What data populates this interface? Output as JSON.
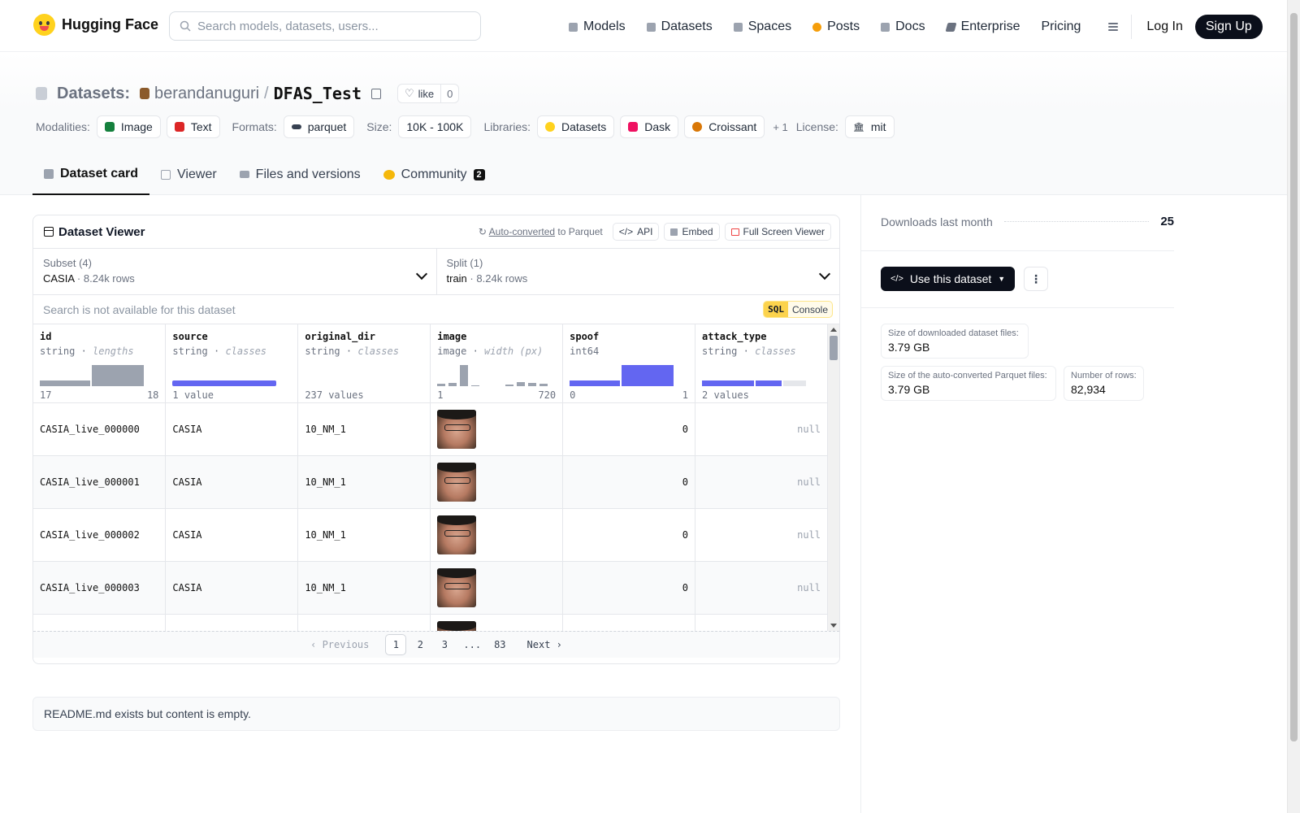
{
  "nav": {
    "brand": "Hugging Face",
    "search_placeholder": "Search models, datasets, users...",
    "links": [
      "Models",
      "Datasets",
      "Spaces",
      "Posts",
      "Docs",
      "Enterprise",
      "Pricing"
    ],
    "login": "Log In",
    "signup": "Sign Up"
  },
  "header": {
    "section": "Datasets:",
    "owner": "berandanuguri",
    "slash": "/",
    "name": "DFAS_Test",
    "like_label": "like",
    "like_count": "0",
    "modalities_label": "Modalities:",
    "modalities": [
      "Image",
      "Text"
    ],
    "formats_label": "Formats:",
    "format": "parquet",
    "size_label": "Size:",
    "size": "10K - 100K",
    "libraries_label": "Libraries:",
    "libraries": [
      "Datasets",
      "Dask",
      "Croissant"
    ],
    "more_libraries": "+ 1",
    "license_label": "License:",
    "license": "mit"
  },
  "tabs": {
    "card": "Dataset card",
    "viewer": "Viewer",
    "files": "Files and versions",
    "community": "Community",
    "community_count": "2"
  },
  "viewer": {
    "title": "Dataset Viewer",
    "auto_converted": "Auto-converted",
    "to_parquet": "to Parquet",
    "api": "API",
    "embed": "Embed",
    "fullscreen": "Full Screen Viewer",
    "subset_label": "Subset (4)",
    "subset_value": "CASIA",
    "subset_rows": "8.24k rows",
    "split_label": "Split (1)",
    "split_value": "train",
    "split_rows": "8.24k rows",
    "search_placeholder": "Search is not available for this dataset",
    "sql": "SQL",
    "console": "Console",
    "columns": [
      {
        "name": "id",
        "type": "string",
        "stat": "lengths",
        "min": "17",
        "max": "18"
      },
      {
        "name": "source",
        "type": "string",
        "stat": "classes",
        "min": "1 value",
        "max": ""
      },
      {
        "name": "original_dir",
        "type": "string",
        "stat": "classes",
        "min": "237 values",
        "max": ""
      },
      {
        "name": "image",
        "type": "image",
        "stat": "width (px)",
        "min": "1",
        "max": "720"
      },
      {
        "name": "spoof",
        "type": "int64",
        "stat": "",
        "min": "0",
        "max": "1"
      },
      {
        "name": "attack_type",
        "type": "string",
        "stat": "classes",
        "min": "2 values",
        "max": ""
      }
    ],
    "rows": [
      {
        "id": "CASIA_live_000000",
        "source": "CASIA",
        "original_dir": "10_NM_1",
        "spoof": "0",
        "attack_type": "null"
      },
      {
        "id": "CASIA_live_000001",
        "source": "CASIA",
        "original_dir": "10_NM_1",
        "spoof": "0",
        "attack_type": "null"
      },
      {
        "id": "CASIA_live_000002",
        "source": "CASIA",
        "original_dir": "10_NM_1",
        "spoof": "0",
        "attack_type": "null"
      },
      {
        "id": "CASIA_live_000003",
        "source": "CASIA",
        "original_dir": "10_NM_1",
        "spoof": "0",
        "attack_type": "null"
      }
    ],
    "pager": {
      "previous": "Previous",
      "pages": [
        "1",
        "2",
        "3",
        "...",
        "83"
      ],
      "next": "Next"
    }
  },
  "sidebar": {
    "downloads_label": "Downloads last month",
    "downloads_value": "25",
    "use_button": "Use this dataset",
    "downloaded_size_label": "Size of downloaded dataset files:",
    "downloaded_size": "3.79 GB",
    "parquet_size_label": "Size of the auto-converted Parquet files:",
    "parquet_size": "3.79 GB",
    "num_rows_label": "Number of rows:",
    "num_rows": "82,934"
  },
  "readme": "README.md exists but content is empty."
}
